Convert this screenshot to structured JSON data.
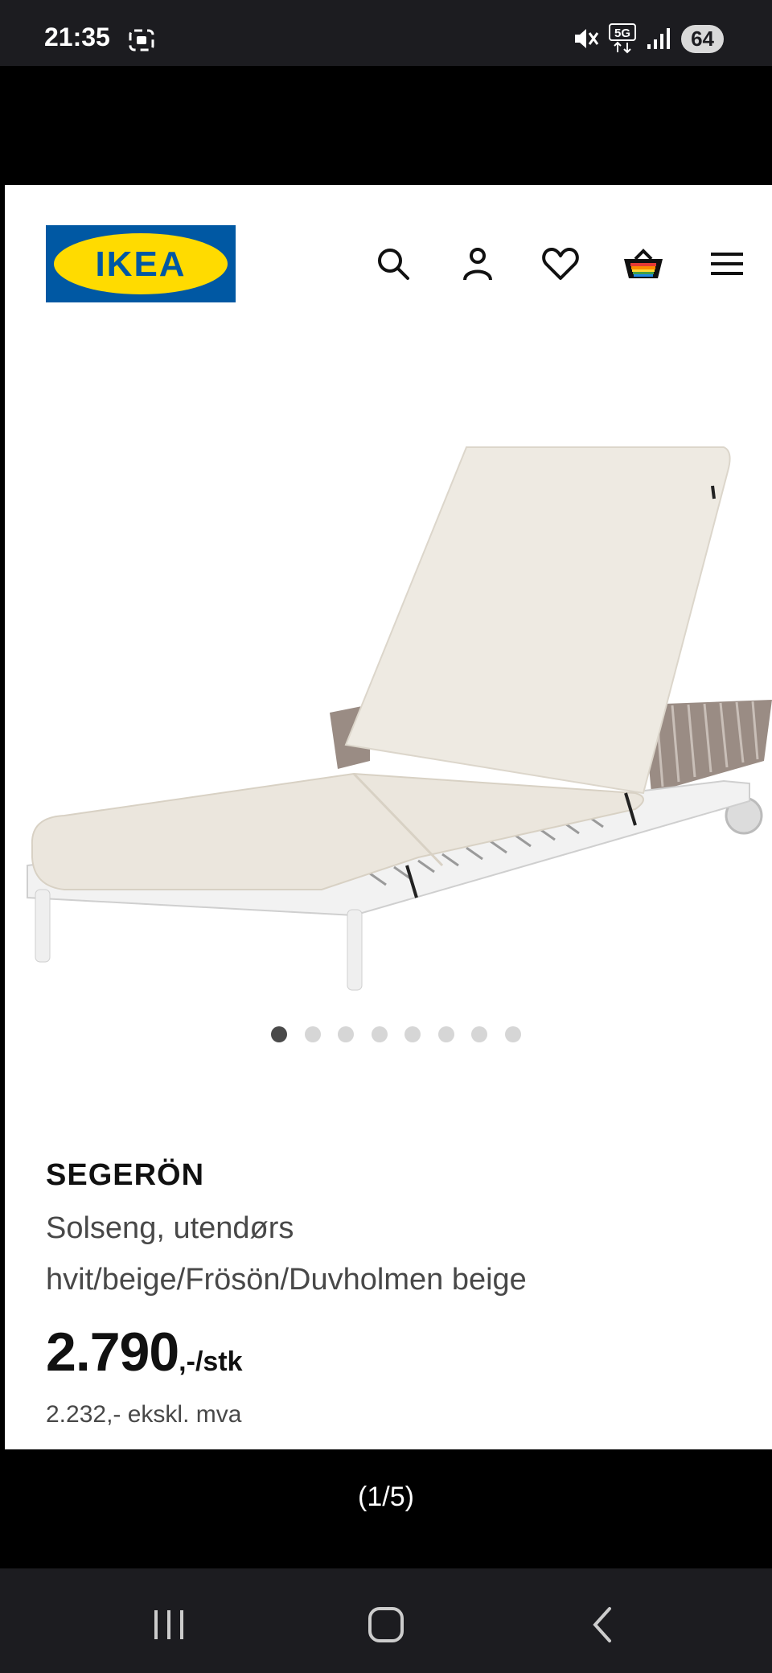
{
  "status_bar": {
    "time": "21:35",
    "battery": "64",
    "network": "5G",
    "icons": [
      "screen-record-icon",
      "mute-icon",
      "5g-icon",
      "signal-icon",
      "battery-icon"
    ]
  },
  "viewer": {
    "page_counter": "(1/5)"
  },
  "header": {
    "logo_text": "IKEA",
    "logo_colors": {
      "blue": "#0058a3",
      "yellow": "#ffdb00"
    },
    "icons": [
      "search-icon",
      "account-icon",
      "heart-icon",
      "basket-icon",
      "menu-icon"
    ]
  },
  "carousel": {
    "total_dots": 8,
    "active_index": 0
  },
  "product": {
    "name": "SEGERÖN",
    "type": "Solseng, utendørs",
    "variant": "hvit/beige/Frösön/Duvholmen beige",
    "price": "2.790",
    "price_suffix": ",-/stk",
    "price_ex_vat": "2.232,- ekskl. mva"
  },
  "nav": {
    "icons": [
      "recent-apps-icon",
      "home-icon",
      "back-icon"
    ]
  }
}
